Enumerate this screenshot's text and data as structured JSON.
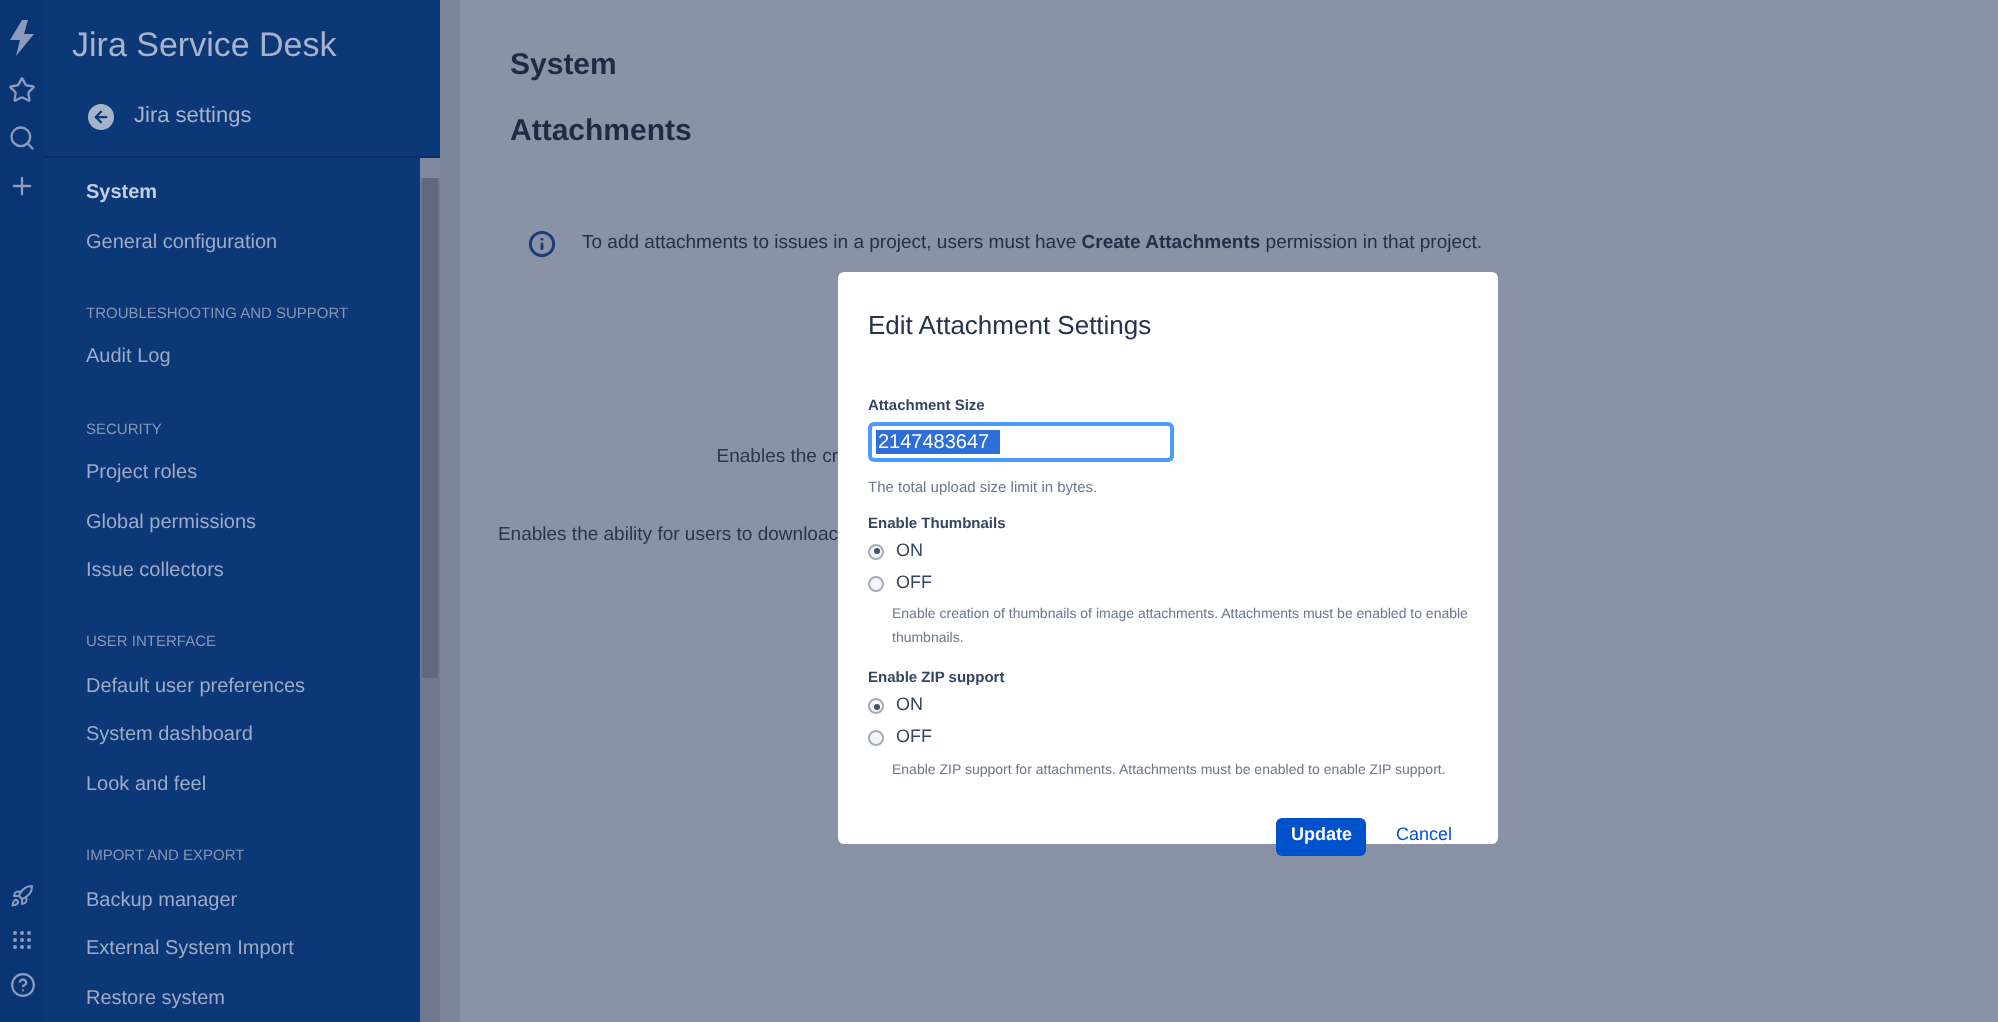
{
  "sidebar": {
    "product": "Jira Service Desk",
    "back_link": "Jira settings",
    "sections": [
      {
        "items": [
          {
            "label": "System",
            "selected": true
          },
          {
            "label": "General configuration",
            "selected": false
          }
        ]
      },
      {
        "heading": "TROUBLESHOOTING AND SUPPORT",
        "items": [
          {
            "label": "Audit Log",
            "selected": false
          }
        ]
      },
      {
        "heading": "SECURITY",
        "items": [
          {
            "label": "Project roles",
            "selected": false
          },
          {
            "label": "Global permissions",
            "selected": false
          },
          {
            "label": "Issue collectors",
            "selected": false
          }
        ]
      },
      {
        "heading": "USER INTERFACE",
        "items": [
          {
            "label": "Default user preferences",
            "selected": false
          },
          {
            "label": "System dashboard",
            "selected": false
          },
          {
            "label": "Look and feel",
            "selected": false
          }
        ]
      },
      {
        "heading": "IMPORT AND EXPORT",
        "items": [
          {
            "label": "Backup manager",
            "selected": false
          },
          {
            "label": "External System Import",
            "selected": false
          },
          {
            "label": "Restore system",
            "selected": false
          }
        ]
      }
    ]
  },
  "main": {
    "breadcrumb": "System",
    "title": "Attachments",
    "info": "To add attachments to issues in a project, users must have **Create Attachments** permission in that project.",
    "covered_texts": [
      "Enables the cr",
      "Enables the ability for users to downloac"
    ]
  },
  "dialog": {
    "title": "Edit Attachment Settings",
    "size_label": "Attachment Size",
    "size_value": "2147483647",
    "size_help": "The total upload size limit in bytes.",
    "groups": [
      {
        "label": "Enable Thumbnails",
        "options": [
          {
            "label": "ON",
            "selected": true
          },
          {
            "label": "OFF",
            "selected": false
          }
        ],
        "help": "Enable creation of thumbnails of image attachments. Attachments must be enabled to enable thumbnails."
      },
      {
        "label": "Enable ZIP support",
        "options": [
          {
            "label": "ON",
            "selected": true
          },
          {
            "label": "OFF",
            "selected": false
          }
        ],
        "help": "Enable ZIP support for attachments. Attachments must be enabled to enable ZIP support."
      }
    ],
    "buttons": {
      "primary": "Update",
      "secondary": "Cancel"
    }
  }
}
